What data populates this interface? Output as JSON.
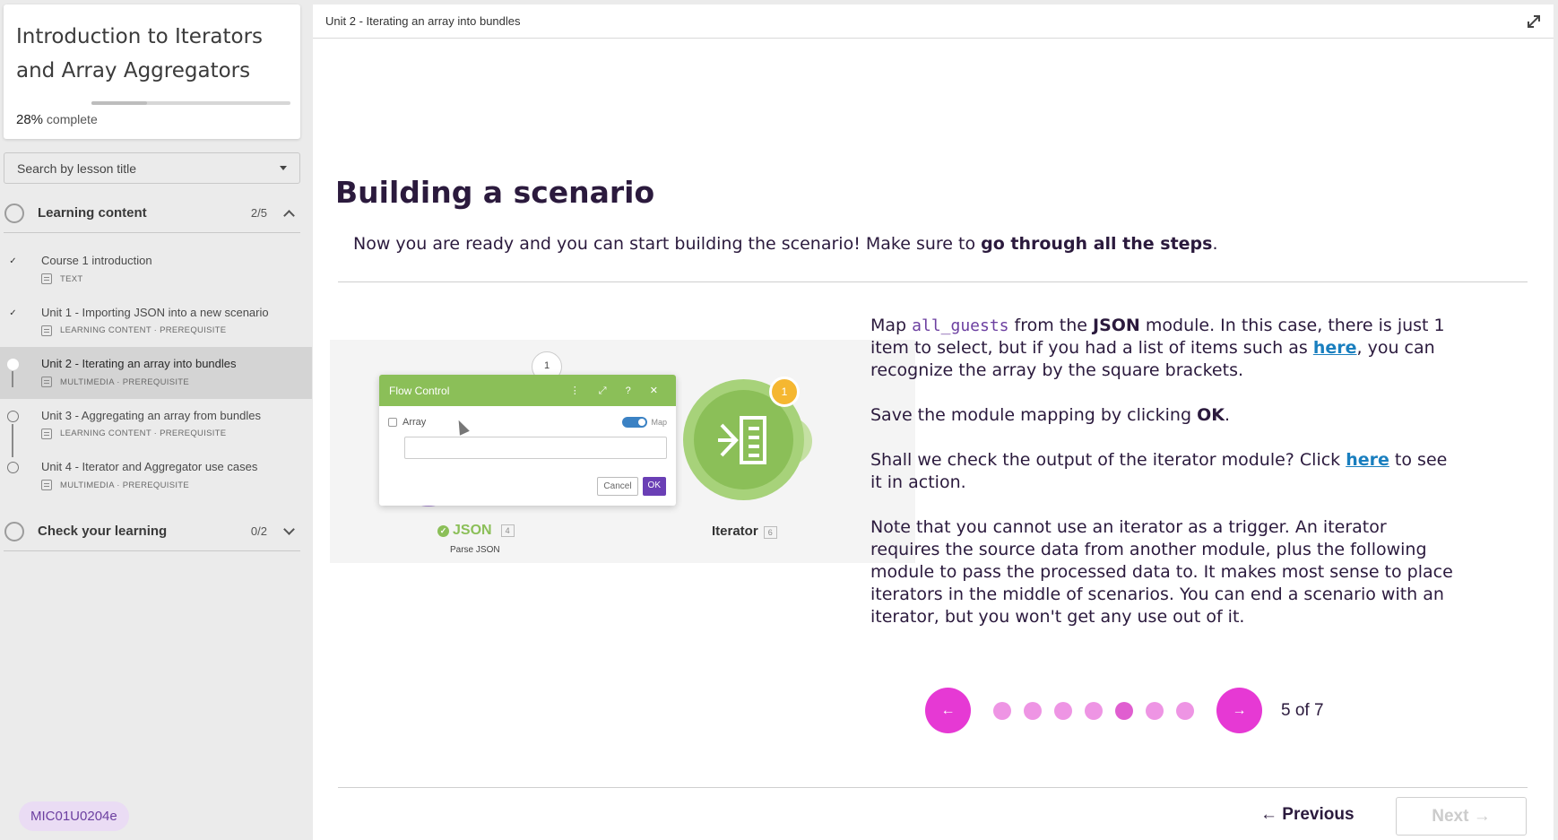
{
  "course": {
    "title": "Introduction to Iterators and Array Aggregators",
    "progress_percent": "28%",
    "progress_value": 0.28,
    "progress_suffix": "complete"
  },
  "search": {
    "placeholder": "Search by lesson title"
  },
  "sections": [
    {
      "title": "Learning content",
      "count": "2/5",
      "expanded": true,
      "lessons": [
        {
          "title": "Course 1 introduction",
          "meta": "TEXT",
          "status": "done"
        },
        {
          "title": "Unit 1 - Importing JSON into a new scenario",
          "meta": "LEARNING CONTENT · PREREQUISITE",
          "status": "done"
        },
        {
          "title": "Unit 2 - Iterating an array into bundles",
          "meta": "MULTIMEDIA · PREREQUISITE",
          "status": "current"
        },
        {
          "title": "Unit 3 - Aggregating an array from bundles",
          "meta": "LEARNING CONTENT · PREREQUISITE",
          "status": "open"
        },
        {
          "title": "Unit 4 - Iterator and Aggregator use cases",
          "meta": "MULTIMEDIA · PREREQUISITE",
          "status": "open"
        }
      ]
    },
    {
      "title": "Check your learning",
      "count": "0/2",
      "expanded": false
    }
  ],
  "main": {
    "breadcrumb": "Unit 2 - Iterating an array into bundles",
    "heading": "Building a scenario",
    "intro_text": "Now you are ready and you can start building the scenario! Make sure to ",
    "intro_bold": "go through all the steps",
    "intro_end": "."
  },
  "illustration": {
    "node_number": "1",
    "dialog_title": "Flow Control",
    "dialog_icons": "⋮ ⤢ ? ✕",
    "array_label": "Array",
    "map_label": "Map",
    "cancel_label": "Cancel",
    "ok_label": "OK",
    "json_label": "JSON",
    "json_num": "4",
    "json_sub": "Parse JSON",
    "iterator_label": "Iterator",
    "iterator_num": "6",
    "badge_num": "1"
  },
  "content": {
    "p1_a": "Map ",
    "p1_code": "all_guests",
    "p1_b": " from the ",
    "p1_bold": "JSON",
    "p1_c": " module. In this case, there is just 1 item to select, but if you had a list of items such as ",
    "p1_link": "here",
    "p1_d": ", you can recognize the array by the square brackets.",
    "p2_a": "Save the module mapping by clicking ",
    "p2_bold": "OK",
    "p2_b": ".",
    "p3_a": "Shall we check the output of the iterator module? Click ",
    "p3_link": "here",
    "p3_b": " to see it in action.",
    "p4": "Note that you cannot use an iterator as a trigger. An iterator requires the source data from another module, plus the following module to pass the processed data to. It makes most sense to place iterators in the middle of scenarios. You can end a scenario with an iterator, but you won't get any use out of it."
  },
  "pager": {
    "label": "5 of 7",
    "total": 7,
    "current": 5,
    "prev_icon": "←",
    "next_icon": "→"
  },
  "footer": {
    "code": "MIC01U0204e",
    "previous_label": "← Previous",
    "next_label": "Next →"
  },
  "colors": {
    "accent": "#e639d4",
    "dot": "#ee95e4",
    "heading": "#2b1a3d",
    "link": "#1a7fbf",
    "badge_bg": "#eadcf4"
  }
}
